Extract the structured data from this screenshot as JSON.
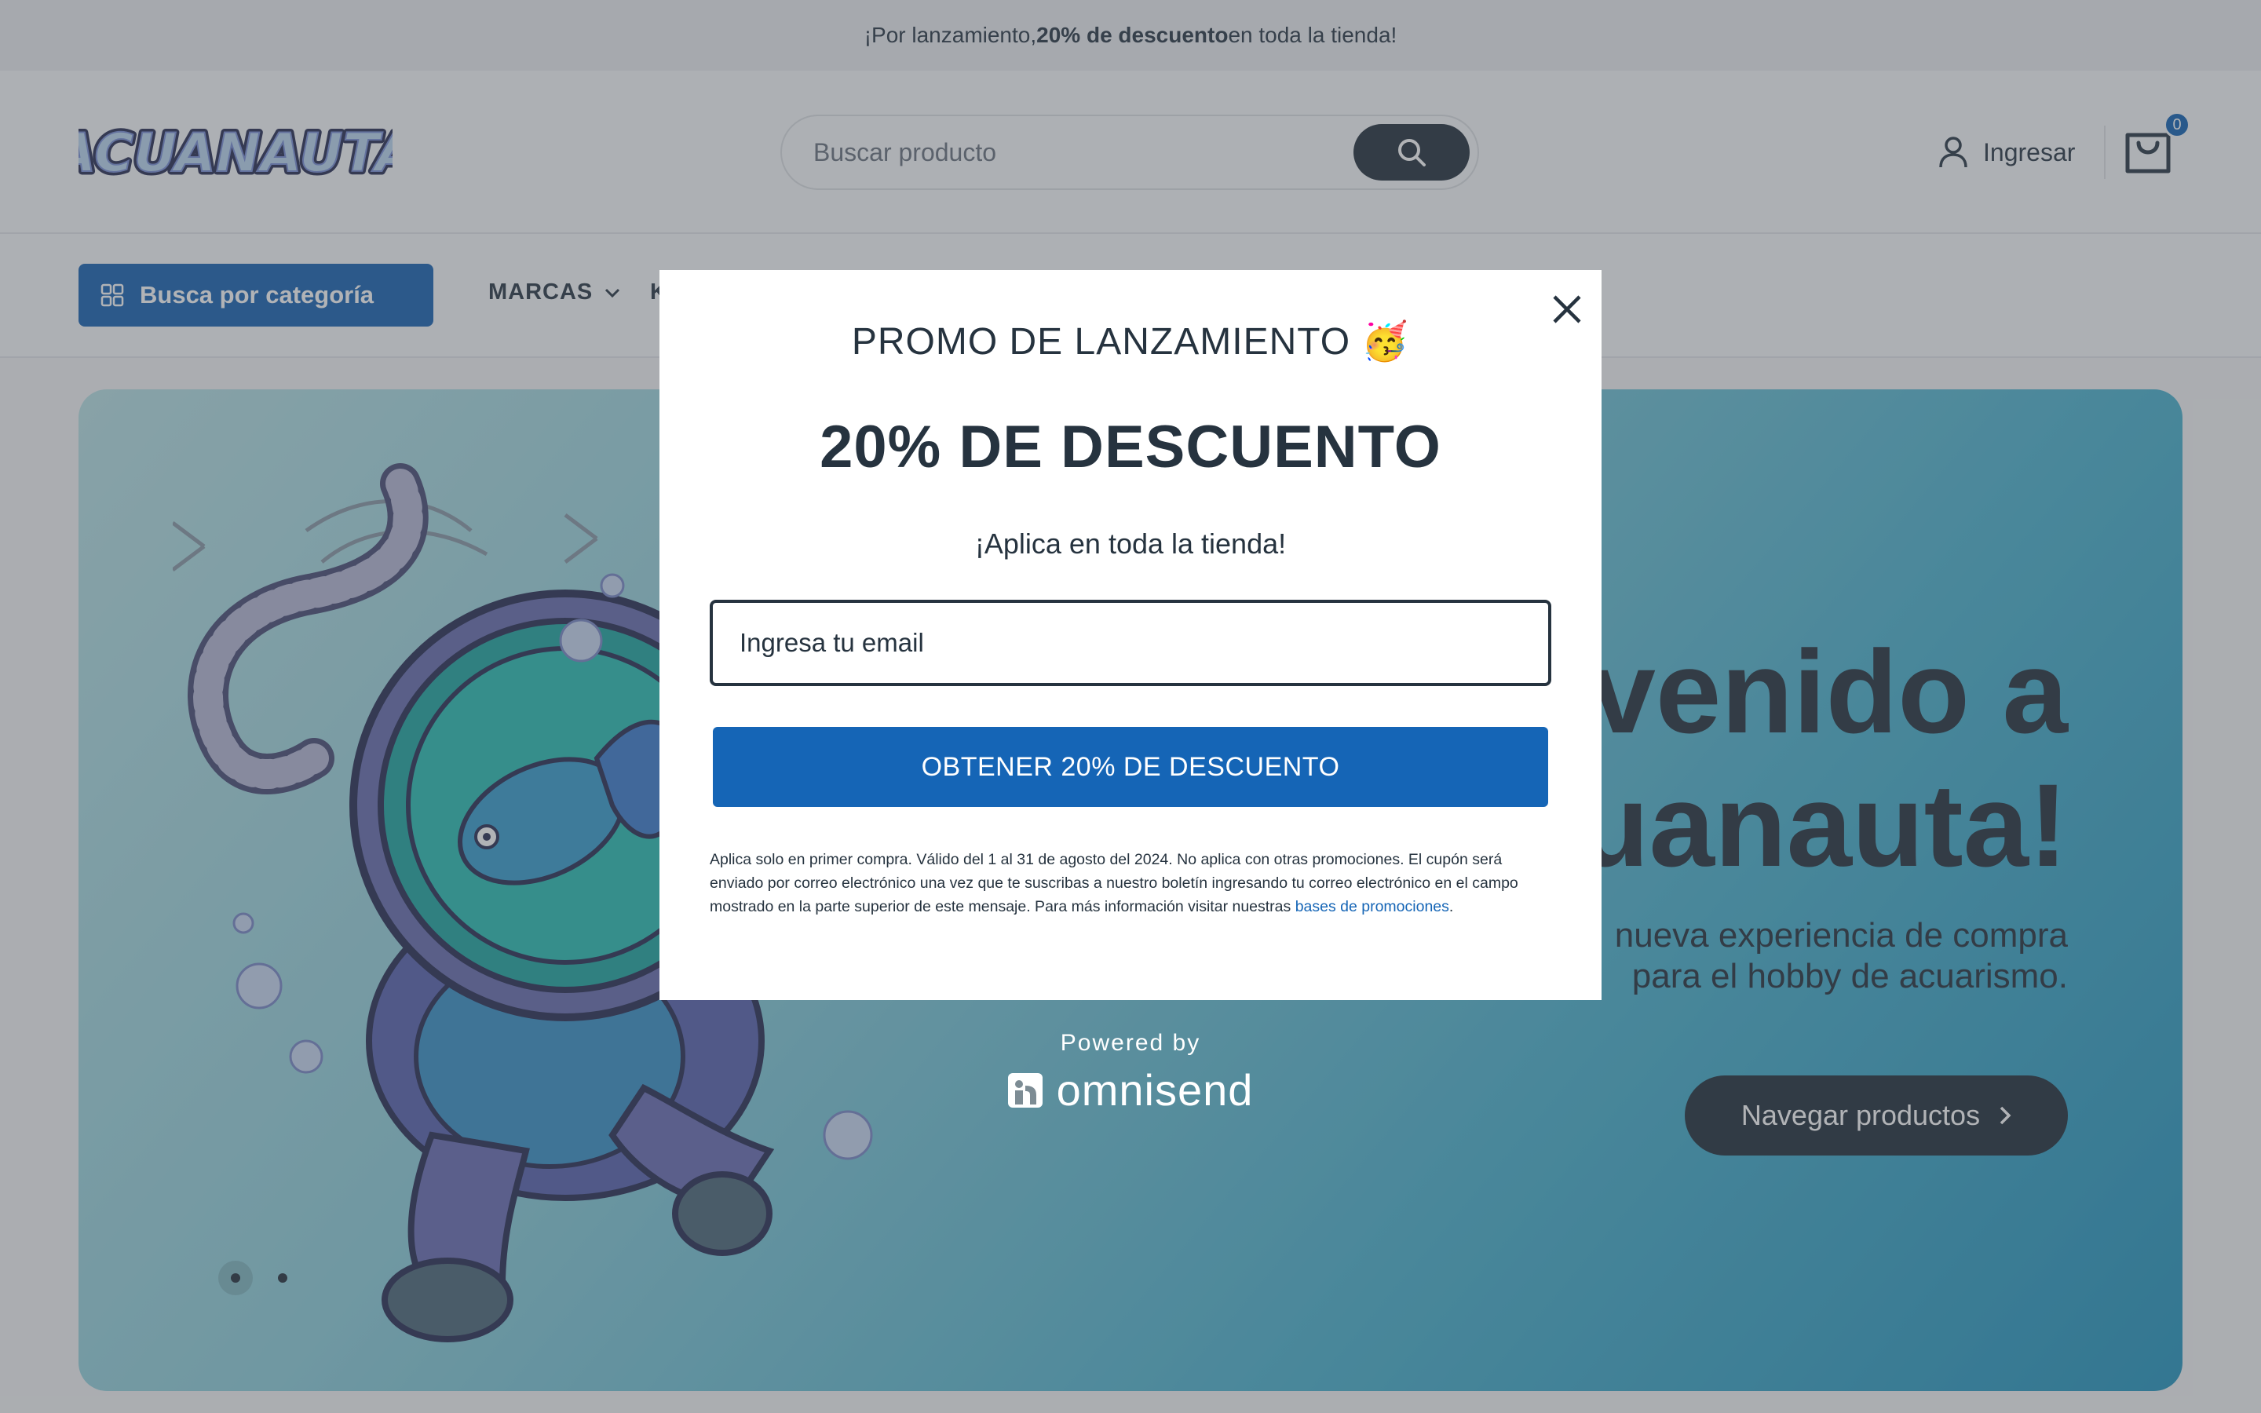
{
  "announcement": {
    "prefix": "¡Por lanzamiento, ",
    "bold": "20% de descuento",
    "suffix": " en toda la tienda!"
  },
  "header": {
    "logo_text": "ACUANAUTA",
    "search_placeholder": "Buscar producto",
    "login_label": "Ingresar",
    "cart_count": "0"
  },
  "nav": {
    "category_button": "Busca por categoría",
    "items": [
      {
        "label": "MARCAS"
      },
      {
        "label": "K"
      }
    ]
  },
  "hero": {
    "title_line1": "nvenido a",
    "title_line2": "cuanauta!",
    "subtitle_line1": "nueva experiencia de compra",
    "subtitle_line2": "para el hobby de acuarismo.",
    "cta_label": "Navegar productos"
  },
  "modal": {
    "title": "PROMO DE LANZAMIENTO",
    "title_emoji": "🥳",
    "headline": "20% DE DESCUENTO",
    "subheadline": "¡Aplica en toda la tienda!",
    "email_placeholder": "Ingresa tu email",
    "submit_label": "OBTENER 20% DE DESCUENTO",
    "fine_print": "Aplica solo en primer compra. Válido del 1 al 31 de agosto del 2024. No aplica con otras promociones. El cupón será enviado por correo electrónico una vez que te suscribas a nuestro boletín ingresando tu correo electrónico en el campo mostrado en la parte superior de este mensaje. Para más información visitar nuestras ",
    "fine_link": "bases de promociones",
    "fine_end": "."
  },
  "powered": {
    "label": "Powered by",
    "brand": "omnisend"
  },
  "colors": {
    "brand_blue": "#1565b6",
    "dark": "#26333f",
    "hero_gradient_start": "#b9e2e6",
    "hero_gradient_end": "#2797c0"
  },
  "icons": [
    "search-icon",
    "user-icon",
    "cart-icon",
    "grid-icon",
    "chevron-down-icon",
    "chevron-right-icon",
    "close-icon",
    "omnisend-logo-icon"
  ]
}
